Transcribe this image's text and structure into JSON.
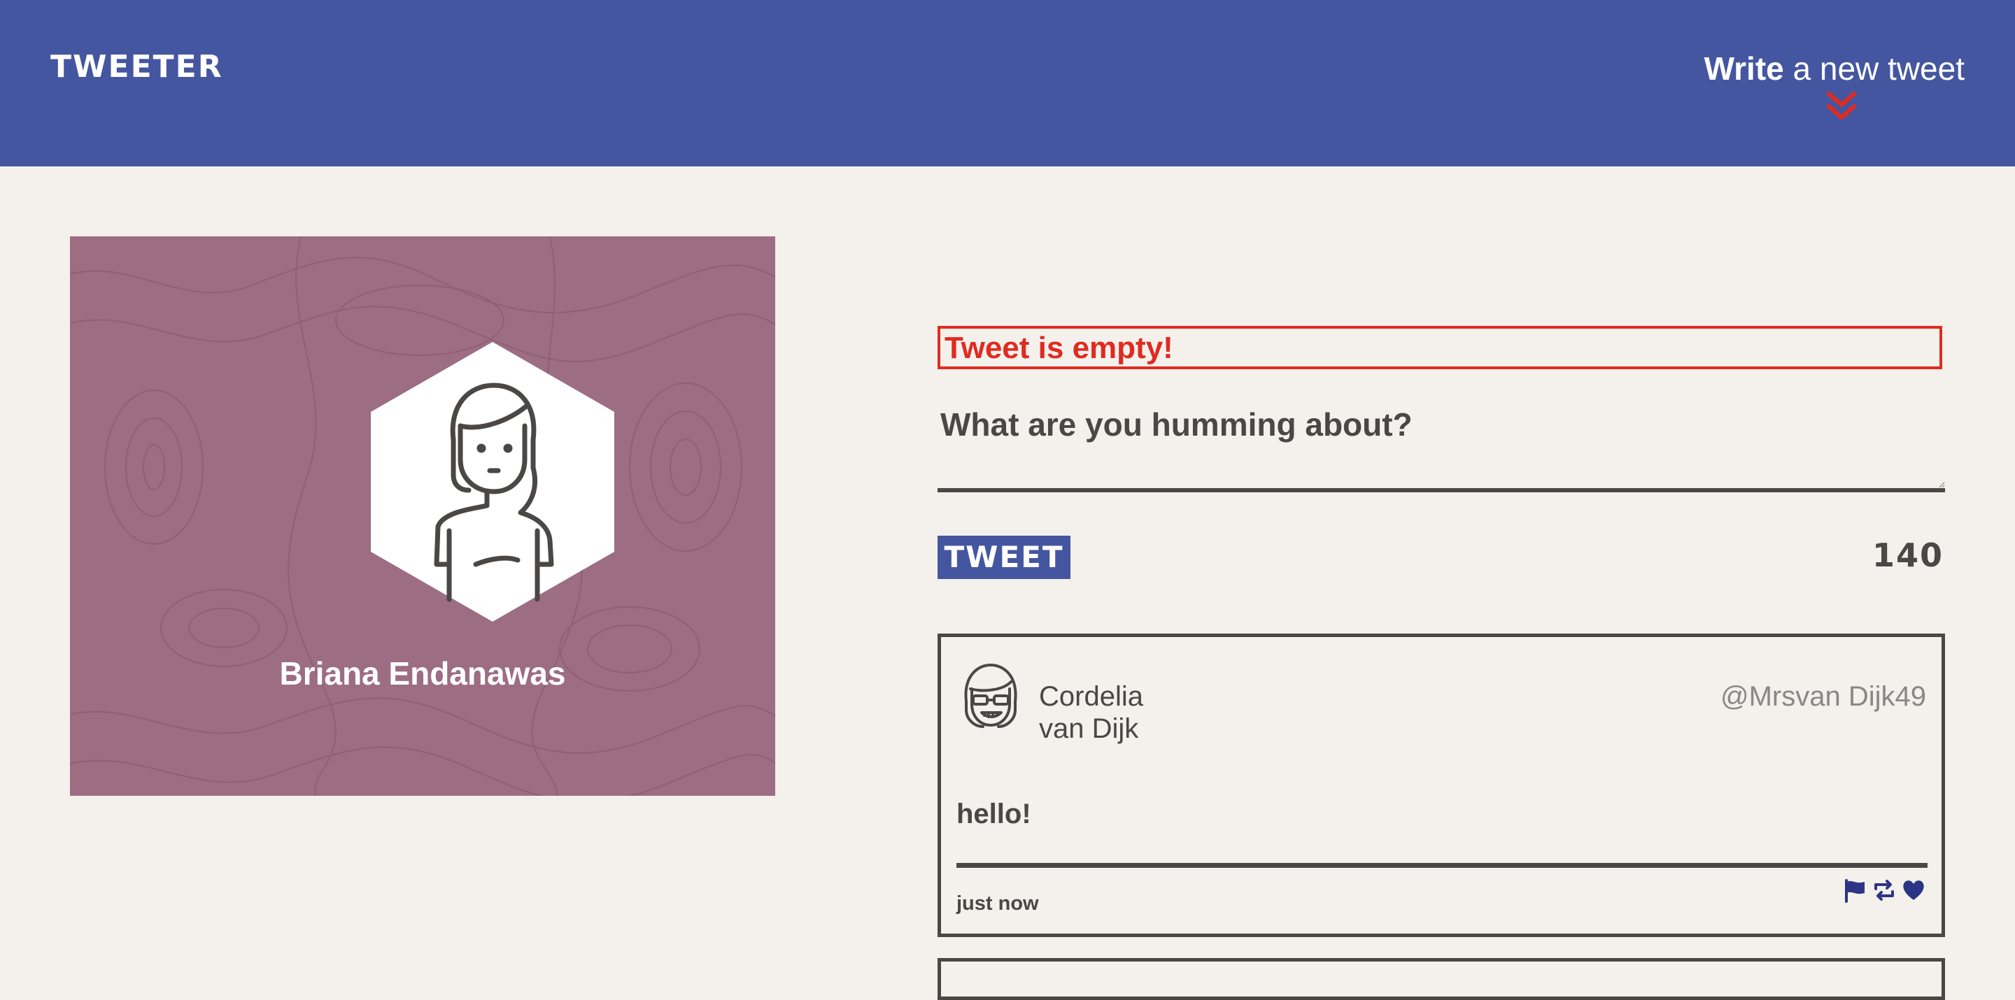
{
  "navbar": {
    "brand": "TWEETER",
    "compose_bold": "Write",
    "compose_rest": " a new tweet",
    "compose_icon": "double-chevron-down-icon",
    "accent_color": "#e02b20",
    "background_color": "#4556a0"
  },
  "profile": {
    "name": "Briana Endanawas",
    "card_color": "#9c6d83",
    "avatar_icon": "woman-avatar-icon"
  },
  "composer": {
    "error_message": "Tweet is empty!",
    "placeholder": "What are you humming about?",
    "value": "",
    "submit_label": "TWEET",
    "counter": "140"
  },
  "tweets": [
    {
      "author_first": "Cordelia",
      "author_last": "van Dijk",
      "handle": "@Mrsvan Dijk49",
      "content": "hello!",
      "timestamp": "just now",
      "avatar_icon": "woman-with-glasses-avatar-icon",
      "actions": [
        "flag-icon",
        "retweet-icon",
        "heart-icon"
      ],
      "action_color": "#2c3585"
    }
  ],
  "page": {
    "background_color": "#f4f1ec",
    "text_color": "#4a4744"
  }
}
